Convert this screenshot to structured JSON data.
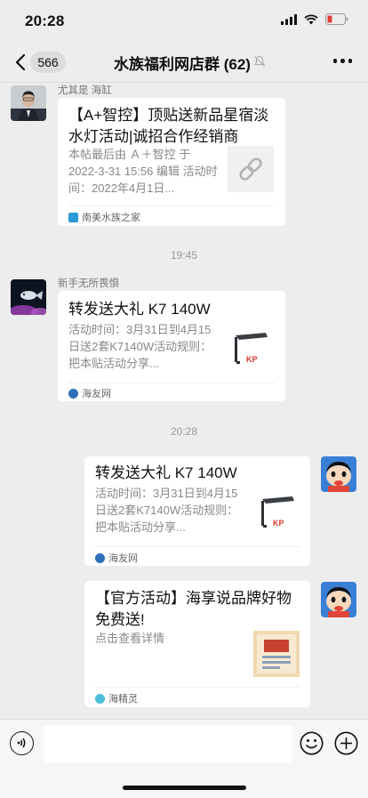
{
  "status_bar": {
    "time": "20:28"
  },
  "header": {
    "back_count": "566",
    "title": "水族福利网店群 (62)"
  },
  "messages": [
    {
      "sender": "尤其是 海缸",
      "title": "【A+智控】顶贴送新品星宿淡水灯活动|诚招合作经销商",
      "desc": "本帖最后由 Ａ＋智控 于 2022-3-31 15:56 编辑 活动时间：2022年4月1日...",
      "source": "南美水族之家",
      "thumb_icon": "link-icon"
    },
    {
      "sender": "新手无所畏惧",
      "title": "转发送大礼 K7 140W",
      "desc": "活动时间：3月31日到4月15日送2套K7140W活动规则：把本贴活动分享...",
      "source": "海友网",
      "thumb_icon": "aquarium-light-icon"
    },
    {
      "title": "转发送大礼 K7 140W",
      "desc": "活动时间：3月31日到4月15日送2套K7140W活动规则：把本贴活动分享...",
      "source": "海友网",
      "thumb_icon": "aquarium-light-icon"
    },
    {
      "title": "【官方活动】海享说品牌好物免费送!",
      "desc": "点击查看详情",
      "source": "海精灵",
      "thumb_icon": "poster-thumbnail"
    }
  ],
  "timestamps": [
    "19:45",
    "20:28"
  ],
  "colors": {
    "background": "#ededed",
    "card": "#ffffff",
    "secondary_text": "#888888"
  }
}
